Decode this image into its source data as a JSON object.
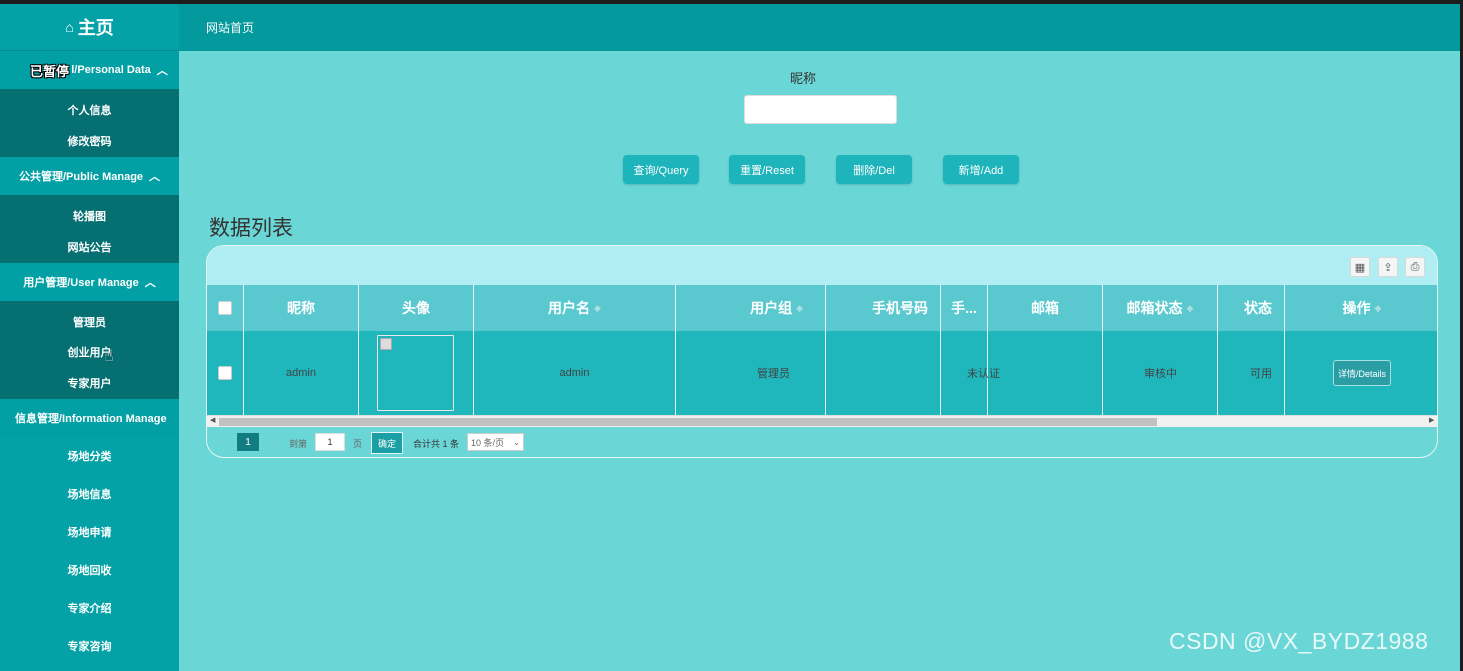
{
  "sidebar": {
    "brand": "主页",
    "paused_overlay": "已暂停",
    "groups": [
      {
        "title": "个人资料/Personal Data",
        "title_visible": "l/Personal Data",
        "items": [
          "个人信息",
          "修改密码"
        ]
      },
      {
        "title": "公共管理/Public Manage",
        "items": [
          "轮播图",
          "网站公告"
        ]
      },
      {
        "title": "用户管理/User Manage",
        "items": [
          "管理员",
          "创业用户",
          "专家用户"
        ]
      },
      {
        "title": "信息管理/Information Manage",
        "items": [
          "场地分类",
          "场地信息",
          "场地申请",
          "场地回收",
          "专家介绍",
          "专家咨询"
        ]
      }
    ]
  },
  "header": {
    "breadcrumb": "网站首页"
  },
  "search": {
    "label": "昵称",
    "placeholder": ""
  },
  "buttons": {
    "query": "查询/Query",
    "reset": "重置/Reset",
    "delete": "删除/Del",
    "add": "新增/Add"
  },
  "list_title": "数据列表",
  "table": {
    "columns": [
      "昵称",
      "头像",
      "用户名",
      "用户组",
      "手机号码",
      "手...",
      "邮箱",
      "邮箱状态",
      "状态",
      "操作"
    ],
    "rows": [
      {
        "nickname": "admin",
        "username": "admin",
        "group": "管理员",
        "phone": "",
        "col6": "未认证",
        "email": "",
        "email_status": "审核中",
        "status": "可用",
        "action": "详情/Details"
      }
    ]
  },
  "pager": {
    "current": "1",
    "goto_label": "到第",
    "page_input": "1",
    "page_unit": "页",
    "confirm": "确定",
    "total": "合计共 1 条",
    "page_size": "10 条/页"
  },
  "watermark": "CSDN @VX_BYDZ1988"
}
